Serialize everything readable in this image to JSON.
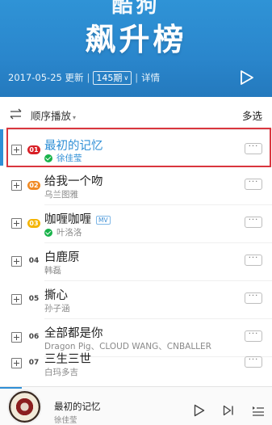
{
  "header": {
    "badge_text": "酷狗",
    "title": "飙升榜",
    "update_date": "2017-05-25 更新",
    "period_value": "145期",
    "detail_link": "详情",
    "background_color": "#2a86cc"
  },
  "toolbar": {
    "order_label": "顺序播放",
    "multi_select_label": "多选"
  },
  "songs": [
    {
      "rank": "01",
      "title": "最初的记忆",
      "artist": "徐佳莹",
      "verified": true,
      "mv": false,
      "active": true,
      "rank_color": "#d81f26"
    },
    {
      "rank": "02",
      "title": "给我一个吻",
      "artist": "乌兰图雅",
      "verified": false,
      "mv": false,
      "active": false,
      "rank_color": "#f08a24"
    },
    {
      "rank": "03",
      "title": "咖喱咖喱",
      "artist": "叶洛洛",
      "verified": true,
      "mv": true,
      "mv_label": "MV",
      "active": false,
      "rank_color": "#f4b400"
    },
    {
      "rank": "04",
      "title": "白鹿原",
      "artist": "韩磊",
      "verified": false,
      "mv": false,
      "active": false
    },
    {
      "rank": "05",
      "title": "撕心",
      "artist": "孙子涵",
      "verified": false,
      "mv": false,
      "active": false
    },
    {
      "rank": "06",
      "title": "全部都是你",
      "artist": "Dragon Pig、CLOUD WANG、CNBALLER",
      "verified": false,
      "mv": false,
      "active": false
    },
    {
      "rank": "07",
      "title": "三生三世",
      "artist": "白玛多吉",
      "verified": false,
      "mv": false,
      "active": false
    }
  ],
  "more_glyph": "···",
  "player": {
    "title": "最初的记忆",
    "artist": "徐佳莹",
    "progress": 0.08,
    "accent_color": "#2f8fd6"
  }
}
